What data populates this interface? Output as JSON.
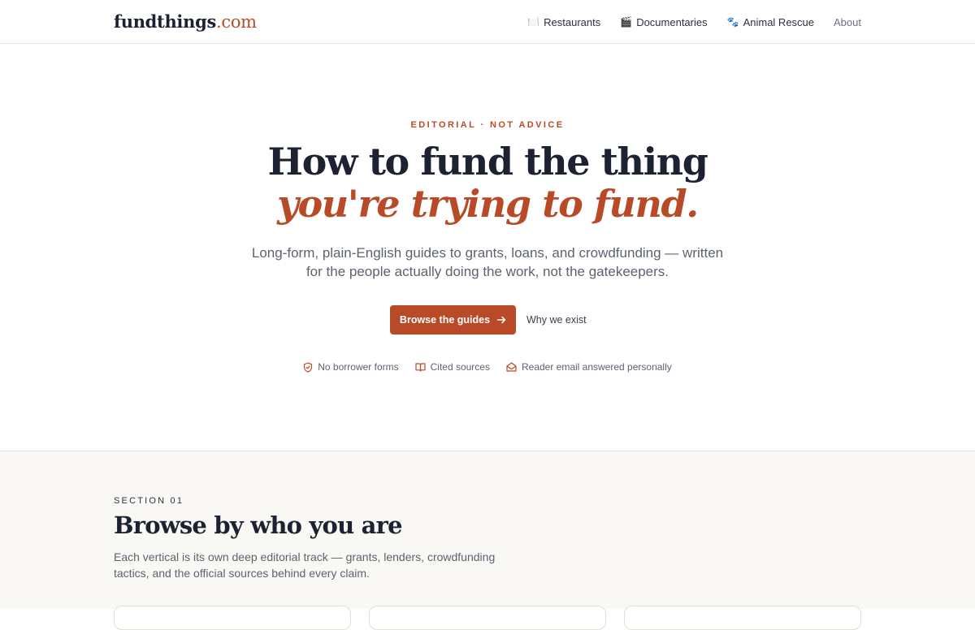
{
  "header": {
    "logo_main": "fundthings",
    "logo_tld": ".com",
    "nav": [
      {
        "icon": "🍽️",
        "label": "Restaurants"
      },
      {
        "icon": "🎬",
        "label": "Documentaries"
      },
      {
        "icon": "🐾",
        "label": "Animal Rescue"
      },
      {
        "icon": "",
        "label": "About"
      }
    ]
  },
  "hero": {
    "eyebrow": "EDITORIAL · NOT ADVICE",
    "title_line1": "How to fund the thing",
    "title_line2": "you're trying to fund.",
    "lede": "Long-form, plain-English guides to grants, loans, and crowdfunding — written for the people actually doing the work, not the gatekeepers.",
    "cta_primary": "Browse the guides",
    "cta_secondary": "Why we exist",
    "badges": [
      {
        "icon": "shield-check-icon",
        "label": "No borrower forms"
      },
      {
        "icon": "book-open-icon",
        "label": "Cited sources"
      },
      {
        "icon": "envelope-open-icon",
        "label": "Reader email answered personally"
      }
    ]
  },
  "section": {
    "label": "SECTION 01",
    "title": "Browse by who you are",
    "description": "Each vertical is its own deep editorial track — grants, lenders, crowdfunding tactics, and the official sources behind every claim."
  },
  "colors": {
    "accent": "#b94a28",
    "ink": "#1c2232",
    "muted": "#5c6270",
    "section_bg": "#faf8f4"
  }
}
